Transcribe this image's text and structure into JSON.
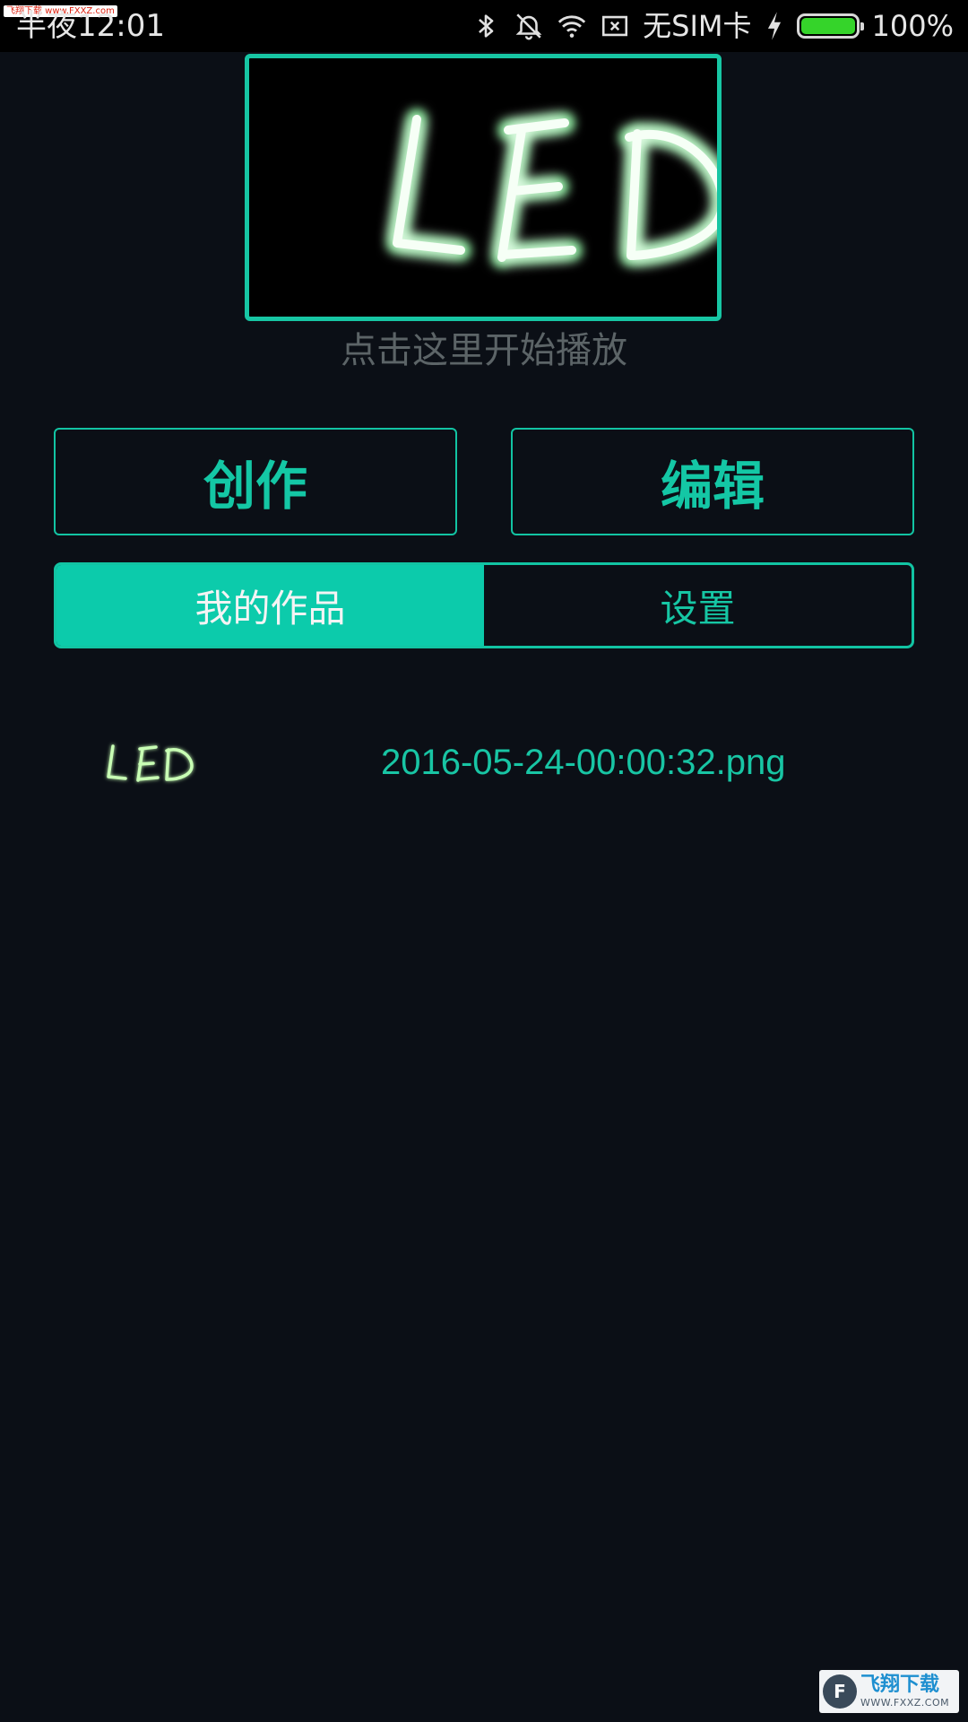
{
  "status_bar": {
    "watermark": "飞翔下载 www.FXXZ.com",
    "time": "半夜12:01",
    "carrier": "无SIM卡",
    "battery_percent_label": "100%",
    "battery_level": 1.0,
    "icons": [
      "bluetooth-icon",
      "vibrate-off-icon",
      "wifi-icon",
      "no-sim-icon",
      "charging-icon",
      "battery-icon"
    ]
  },
  "preview": {
    "led_text": "LED",
    "hint": "点击这里开始播放",
    "glow_color": "#7dff9a",
    "border_color": "#17c6a4"
  },
  "actions": {
    "create_label": "创作",
    "edit_label": "编辑"
  },
  "tabs": [
    {
      "label": "我的作品",
      "active": true
    },
    {
      "label": "设置",
      "active": false
    }
  ],
  "works": [
    {
      "thumbnail_text": "LED",
      "filename": "2016-05-24-00:00:32.png"
    }
  ],
  "watermark_bottom": {
    "title": "飞翔下载",
    "url": "WWW.FXXZ.COM"
  },
  "colors": {
    "accent": "#0ccbab",
    "background": "#0b0f16",
    "hint": "#5c6467"
  }
}
